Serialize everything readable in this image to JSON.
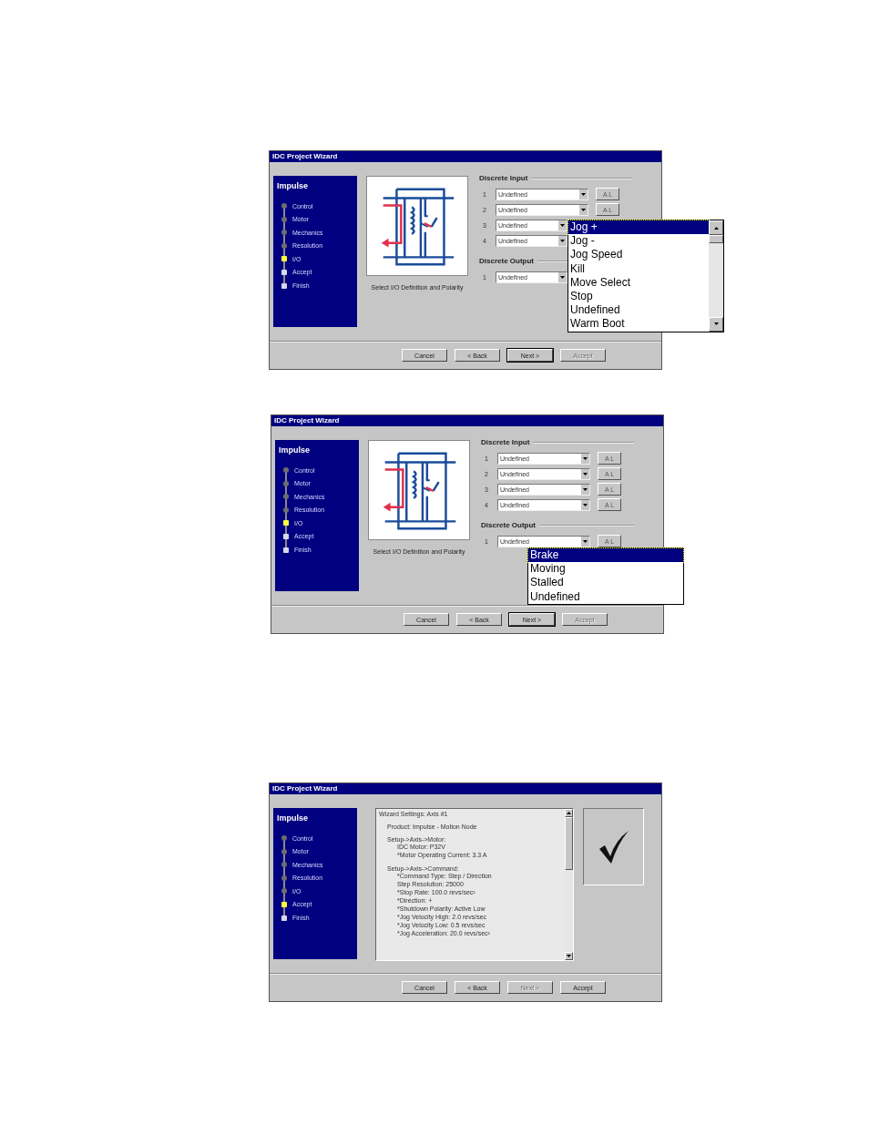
{
  "windows": [
    {
      "title": "IDC Project Wizard",
      "kind": "io",
      "sidebar": {
        "title": "Impulse",
        "steps": [
          {
            "label": "Control",
            "kind": "done"
          },
          {
            "label": "Motor",
            "kind": "done"
          },
          {
            "label": "Mechanics",
            "kind": "done"
          },
          {
            "label": "Resolution",
            "kind": "done"
          },
          {
            "label": "I/O",
            "kind": "current"
          },
          {
            "label": "Accept",
            "kind": "pending"
          },
          {
            "label": "Finish",
            "kind": "pending"
          }
        ]
      },
      "caption": "Select I/O Definition and Polarity",
      "groups": [
        {
          "title": "Discrete Input",
          "rows": [
            {
              "number": "1",
              "value": "Undefined",
              "button": "A L"
            },
            {
              "number": "2",
              "value": "Undefined",
              "button": "A L"
            },
            {
              "number": "3",
              "value": "Undefined"
            },
            {
              "number": "4",
              "value": "Undefined"
            }
          ]
        },
        {
          "title": "Discrete Output",
          "rows": [
            {
              "number": "1",
              "value": "Undefined"
            }
          ]
        }
      ],
      "dropdown": {
        "scrollbar": true,
        "items": [
          {
            "label": "Jog +",
            "selected": true
          },
          {
            "label": "Jog -",
            "selected": false
          },
          {
            "label": "Jog Speed",
            "selected": false
          },
          {
            "label": "Kill",
            "selected": false
          },
          {
            "label": "Move Select",
            "selected": false
          },
          {
            "label": "Stop",
            "selected": false
          },
          {
            "label": "Undefined",
            "selected": false
          },
          {
            "label": "Warm Boot",
            "selected": false
          }
        ]
      },
      "buttons": [
        {
          "label": "Cancel",
          "disabled": false,
          "default": false
        },
        {
          "label": "< Back",
          "disabled": false,
          "default": false
        },
        {
          "label": "Next >",
          "disabled": false,
          "default": true
        },
        {
          "label": "Accept",
          "disabled": true,
          "default": false
        }
      ]
    },
    {
      "title": "IDC Project Wizard",
      "kind": "io",
      "sidebar": {
        "title": "Impulse",
        "steps": [
          {
            "label": "Control",
            "kind": "done"
          },
          {
            "label": "Motor",
            "kind": "done"
          },
          {
            "label": "Mechanics",
            "kind": "done"
          },
          {
            "label": "Resolution",
            "kind": "done"
          },
          {
            "label": "I/O",
            "kind": "current"
          },
          {
            "label": "Accept",
            "kind": "pending"
          },
          {
            "label": "Finish",
            "kind": "pending"
          }
        ]
      },
      "caption": "Select I/O Definition and Polarity",
      "groups": [
        {
          "title": "Discrete Input",
          "rows": [
            {
              "number": "1",
              "value": "Undefined",
              "button": "A L"
            },
            {
              "number": "2",
              "value": "Undefined",
              "button": "A L"
            },
            {
              "number": "3",
              "value": "Undefined",
              "button": "A L"
            },
            {
              "number": "4",
              "value": "Undefined",
              "button": "A L"
            }
          ]
        },
        {
          "title": "Discrete Output",
          "rows": [
            {
              "number": "1",
              "value": "Undefined",
              "button": "A L"
            }
          ]
        }
      ],
      "dropdown": {
        "scrollbar": false,
        "items": [
          {
            "label": "Brake",
            "selected": true
          },
          {
            "label": "Moving",
            "selected": false
          },
          {
            "label": "Stalled",
            "selected": false
          },
          {
            "label": "Undefined",
            "selected": false
          }
        ]
      },
      "buttons": [
        {
          "label": "Cancel",
          "disabled": false,
          "default": false
        },
        {
          "label": "< Back",
          "disabled": false,
          "default": false
        },
        {
          "label": "Next >",
          "disabled": false,
          "default": true
        },
        {
          "label": "Accept",
          "disabled": true,
          "default": false
        }
      ]
    },
    {
      "title": "IDC Project Wizard",
      "kind": "summary",
      "sidebar": {
        "title": "Impulse",
        "steps": [
          {
            "label": "Control",
            "kind": "done"
          },
          {
            "label": "Motor",
            "kind": "done"
          },
          {
            "label": "Mechanics",
            "kind": "done"
          },
          {
            "label": "Resolution",
            "kind": "done"
          },
          {
            "label": "I/O",
            "kind": "done"
          },
          {
            "label": "Accept",
            "kind": "current"
          },
          {
            "label": "Finish",
            "kind": "pending"
          }
        ]
      },
      "summary": {
        "title": "Wizard Settings:  Axis #1",
        "sections": [
          {
            "heading": "Product:  Impulse - Motion Node"
          },
          {
            "heading": "Setup->Axis->Motor:",
            "lines": [
              "IDC Motor:  P32V",
              "*Motor Operating Current:  3.3 A"
            ]
          },
          {
            "heading": "Setup->Axis->Command:",
            "lines": [
              "*Command Type:  Step / Direction",
              "Step Resolution:  25000",
              "*Stop Rate:  100.0 revs/sec²",
              "*Direction:  +",
              "*Shutdown Polarity:  Active Low",
              "*Jog Velocity High:  2.0 revs/sec",
              "*Jog Velocity Low:  0.5 revs/sec",
              "*Jog Acceleration:  20.0 revs/sec²"
            ]
          }
        ]
      },
      "buttons": [
        {
          "label": "Cancel",
          "disabled": false,
          "default": false
        },
        {
          "label": "< Back",
          "disabled": false,
          "default": false
        },
        {
          "label": "Next >",
          "disabled": true,
          "default": false
        },
        {
          "label": "Accept",
          "disabled": false,
          "default": false
        }
      ]
    }
  ]
}
